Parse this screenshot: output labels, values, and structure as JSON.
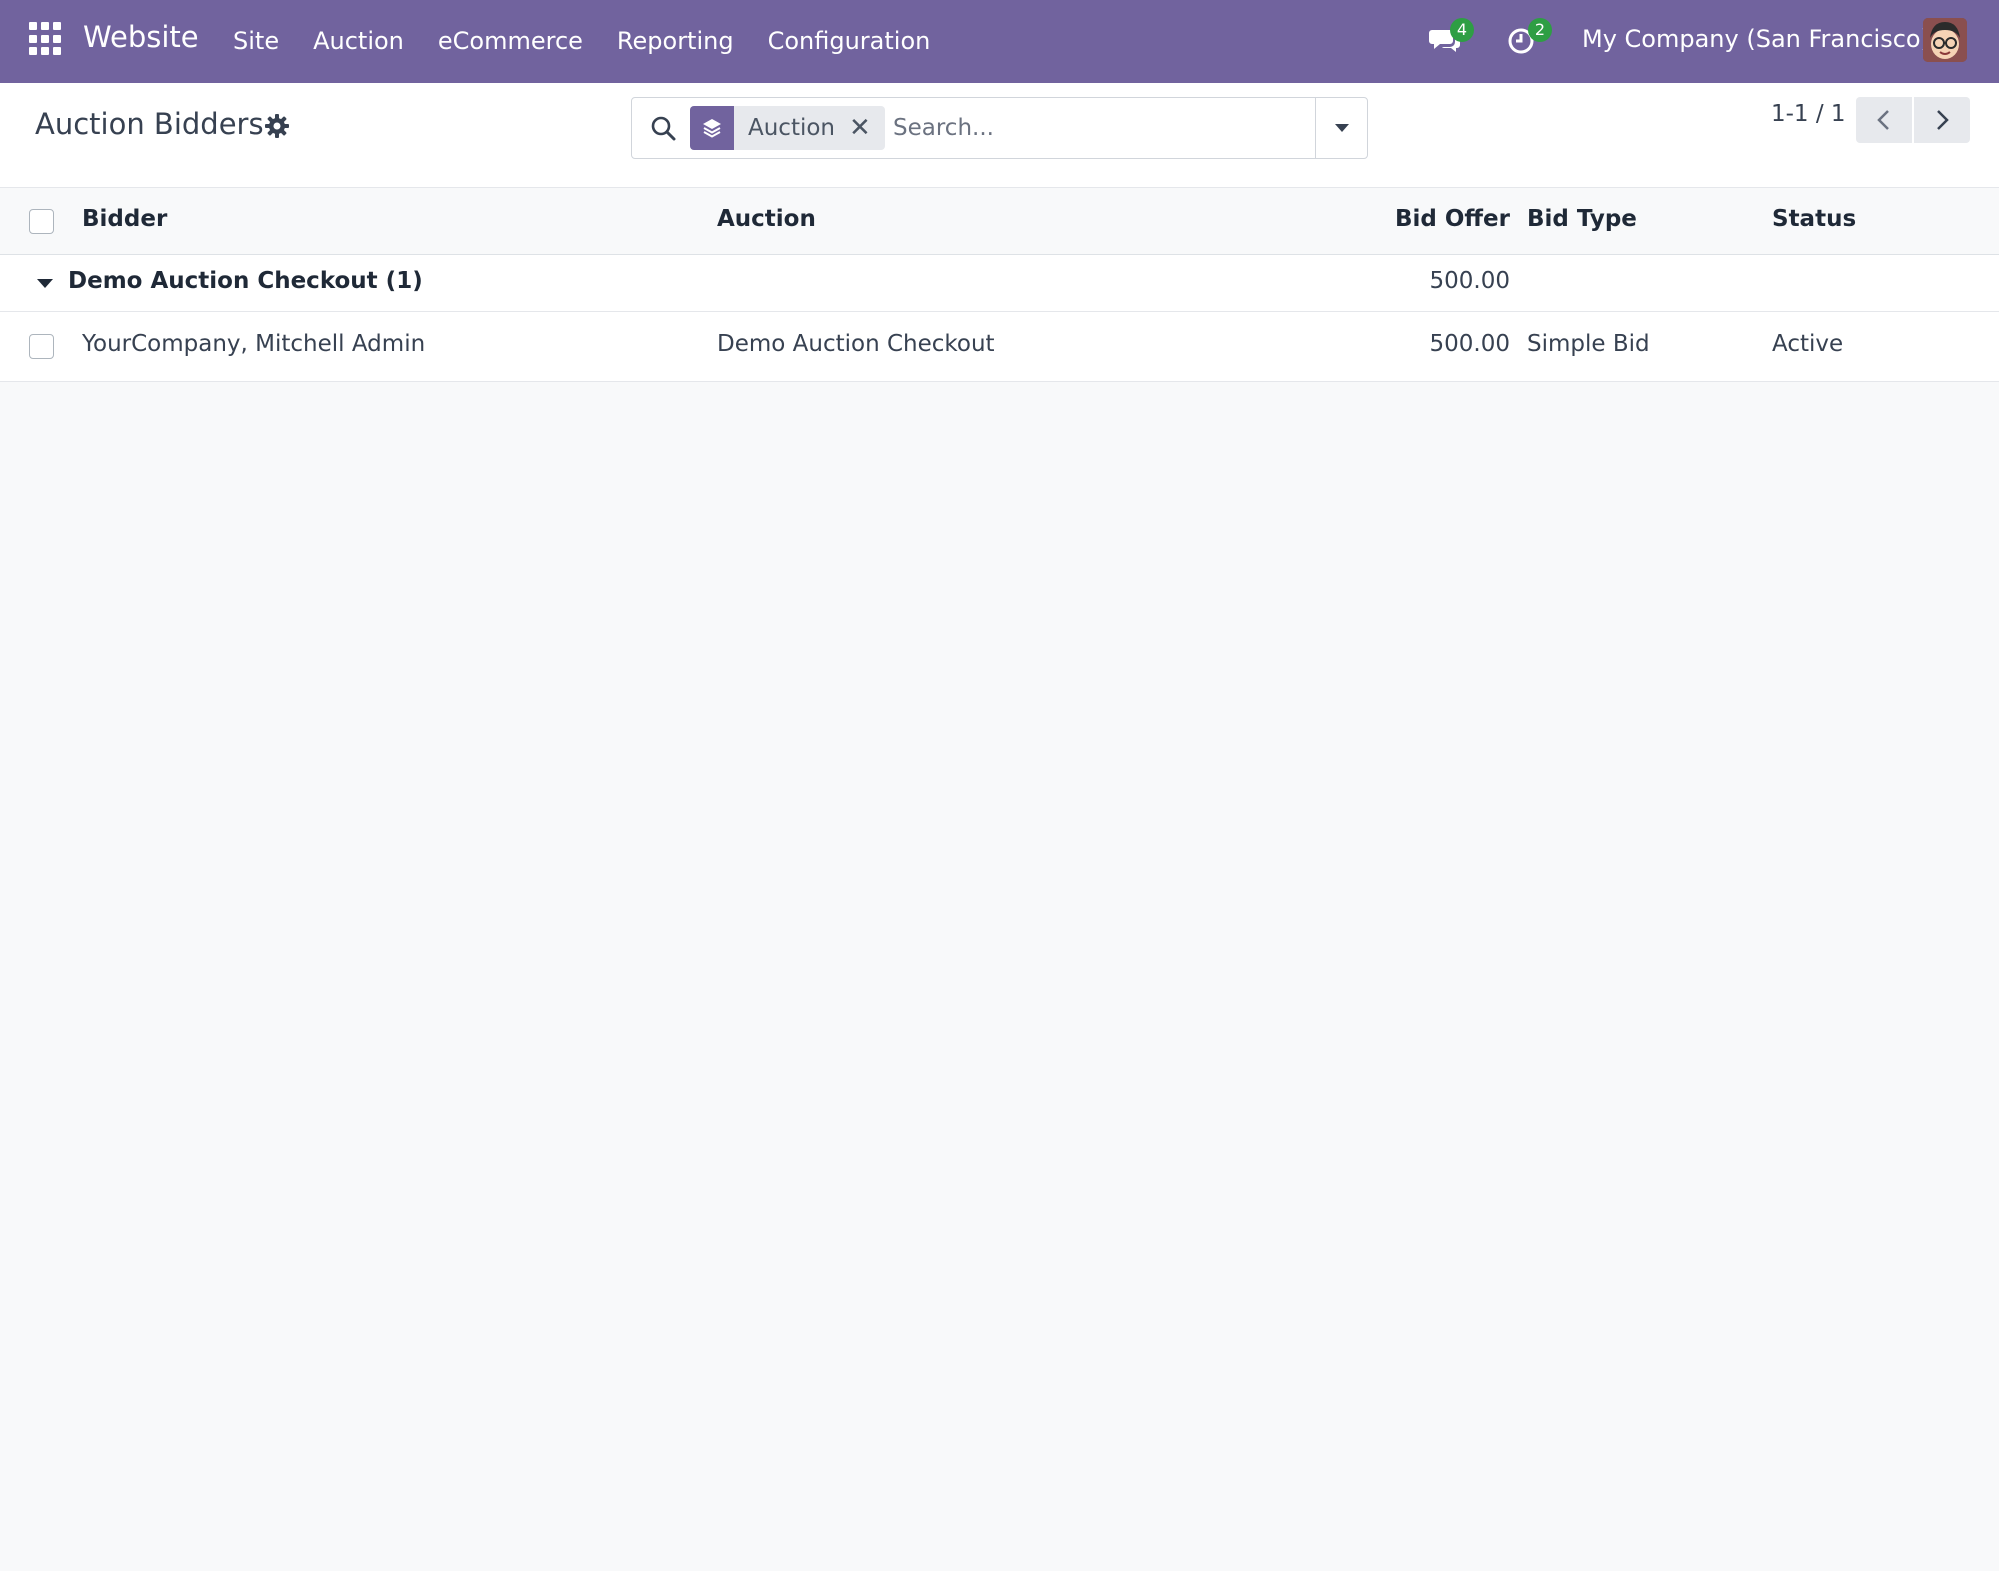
{
  "navbar": {
    "app_name": "Website",
    "menu": [
      "Site",
      "Auction",
      "eCommerce",
      "Reporting",
      "Configuration"
    ],
    "messages_count": "4",
    "activities_count": "2",
    "company": "My Company (San Francisco)",
    "accent_color": "#71639e",
    "badge_color": "#2e9e44"
  },
  "control_panel": {
    "title": "Auction Bidders",
    "search": {
      "facet_label": "Auction",
      "placeholder": "Search..."
    },
    "pager": "1-1 / 1"
  },
  "table": {
    "columns": [
      "Bidder",
      "Auction",
      "Bid Offer",
      "Bid Type",
      "Status"
    ],
    "group": {
      "label": "Demo Auction Checkout (1)",
      "bid_offer_total": "500.00"
    },
    "rows": [
      {
        "bidder": "YourCompany, Mitchell Admin",
        "auction": "Demo Auction Checkout",
        "bid_offer": "500.00",
        "bid_type": "Simple Bid",
        "status": "Active"
      }
    ]
  }
}
